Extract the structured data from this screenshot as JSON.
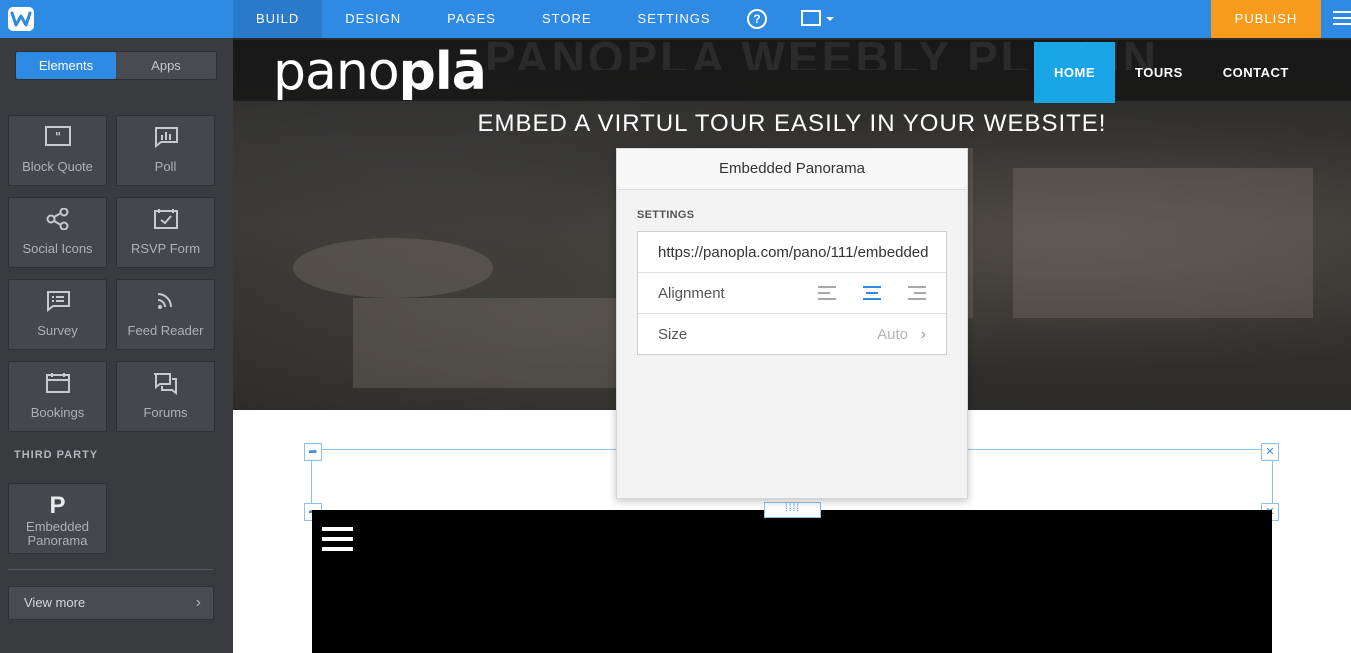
{
  "topbar": {
    "nav": [
      "BUILD",
      "DESIGN",
      "PAGES",
      "STORE",
      "SETTINGS"
    ],
    "help": "?",
    "publish": "PUBLISH"
  },
  "sidebar": {
    "tabs": [
      "Elements",
      "Apps"
    ],
    "elements": [
      {
        "label": "Block Quote",
        "icon": "quote-icon"
      },
      {
        "label": "Poll",
        "icon": "poll-icon"
      },
      {
        "label": "Social Icons",
        "icon": "share-icon"
      },
      {
        "label": "RSVP Form",
        "icon": "rsvp-icon"
      },
      {
        "label": "Survey",
        "icon": "survey-icon"
      },
      {
        "label": "Feed Reader",
        "icon": "rss-icon"
      },
      {
        "label": "Bookings",
        "icon": "calendar-icon"
      },
      {
        "label": "Forums",
        "icon": "forum-icon"
      }
    ],
    "third_party_label": "THIRD PARTY",
    "third_party": {
      "letter": "P",
      "label": "Embedded Panorama"
    },
    "view_more": "View more"
  },
  "site": {
    "ghost": "PANOPLA WEEBLY PLUGIN",
    "logo_thin": "pano",
    "logo_bold": "plā",
    "nav": [
      "HOME",
      "TOURS",
      "CONTACT"
    ],
    "hero_title": "EMBED A VIRTUL TOUR EASILY IN YOUR WEBSITE!"
  },
  "popover": {
    "title": "Embedded Panorama",
    "section": "SETTINGS",
    "url": "https://panopla.com/pano/111/embedded",
    "alignment_label": "Alignment",
    "alignment_selected": "center",
    "size_label": "Size",
    "size_value": "Auto"
  },
  "colors": {
    "accent": "#2f8ae4",
    "publish": "#f89a1c",
    "site_nav_active": "#1aa6e6"
  }
}
